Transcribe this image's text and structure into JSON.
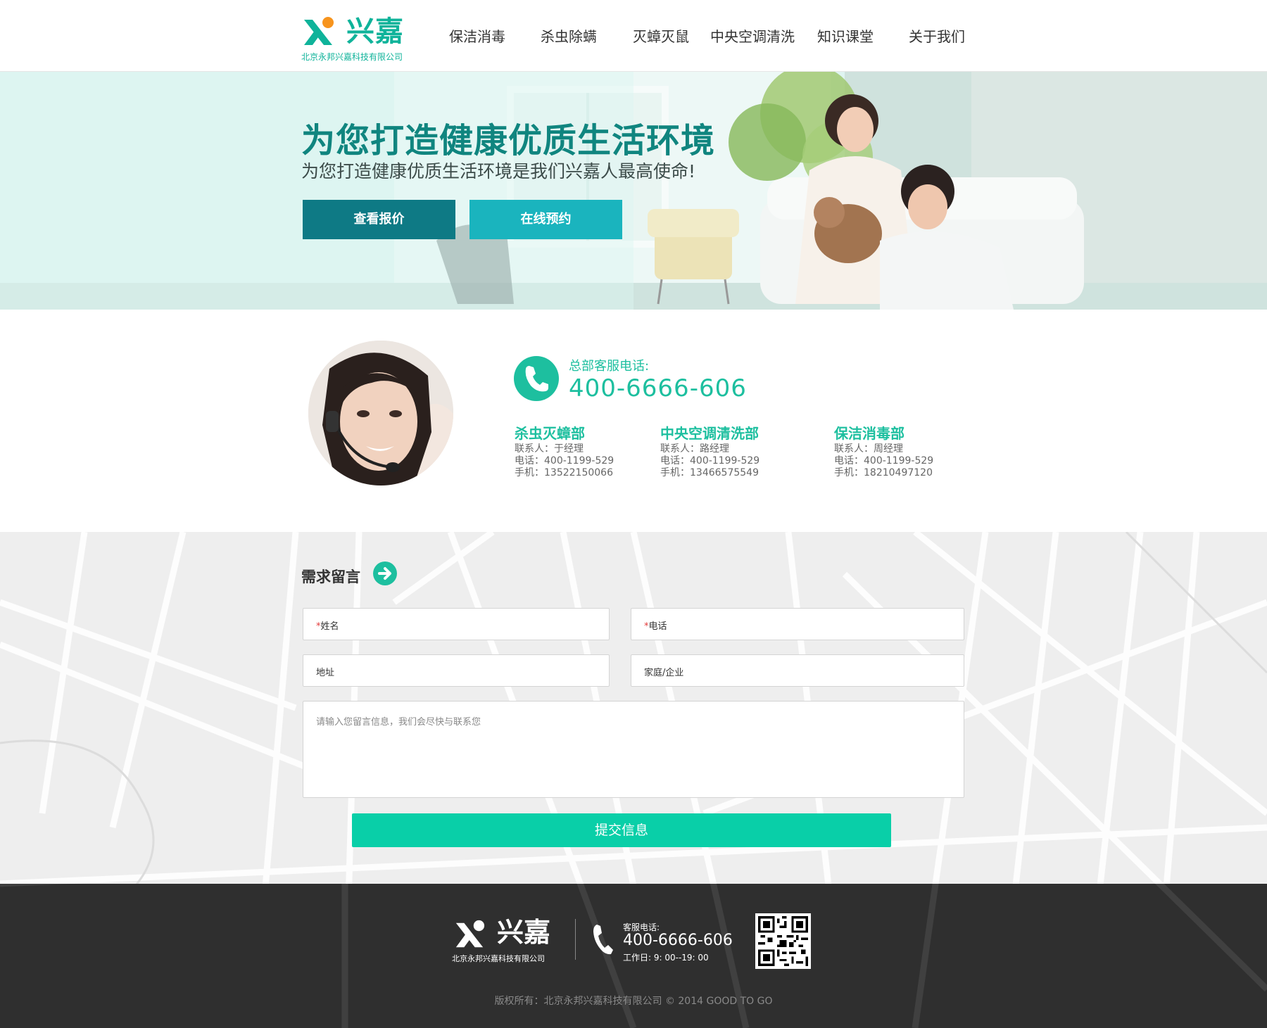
{
  "brand": {
    "name": "兴嘉",
    "company": "北京永邦兴嘉科技有限公司",
    "primary_color": "#0fb39a",
    "accent_color": "#09cfa8"
  },
  "nav": {
    "items": [
      {
        "label": "保洁消毒"
      },
      {
        "label": "杀虫除螨"
      },
      {
        "label": "灭蟑灭鼠"
      },
      {
        "label": "中央空调清洗"
      },
      {
        "label": "知识课堂"
      },
      {
        "label": "关于我们"
      }
    ]
  },
  "hero": {
    "title": "为您打造健康优质生活环境",
    "subtitle": "为您打造健康优质生活环境是我们兴嘉人最高使命!",
    "btn_quote": "查看报价",
    "btn_book": "在线预约"
  },
  "contact": {
    "hq_label": "总部客服电话:",
    "hq_number": "400-6666-606",
    "departments": [
      {
        "name": "杀虫灭蟑部",
        "contact": "联系人：于经理",
        "phone": "电话：400-1199-529",
        "mobile": "手机：13522150066"
      },
      {
        "name": "中央空调清洗部",
        "contact": "联系人：路经理",
        "phone": "电话：400-1199-529",
        "mobile": "手机：13466575549"
      },
      {
        "name": "保洁消毒部",
        "contact": "联系人：周经理",
        "phone": "电话：400-1199-529",
        "mobile": "手机：18210497120"
      }
    ]
  },
  "form": {
    "title": "需求留言",
    "required_mark": "*",
    "name_label": "姓名",
    "phone_label": "电话",
    "address_label": "地址",
    "type_label": "家庭/企业",
    "message_placeholder": "请输入您留言信息，我们会尽快与联系您",
    "submit_label": "提交信息"
  },
  "footer": {
    "logo_name": "兴嘉",
    "company": "北京永邦兴嘉科技有限公司",
    "service_label": "客服电话:",
    "service_number": "400-6666-606",
    "hours": "工作日: 9: 00--19: 00",
    "copyright": "版权所有：北京永邦兴嘉科技有限公司 © 2014 GOOD TO GO"
  }
}
